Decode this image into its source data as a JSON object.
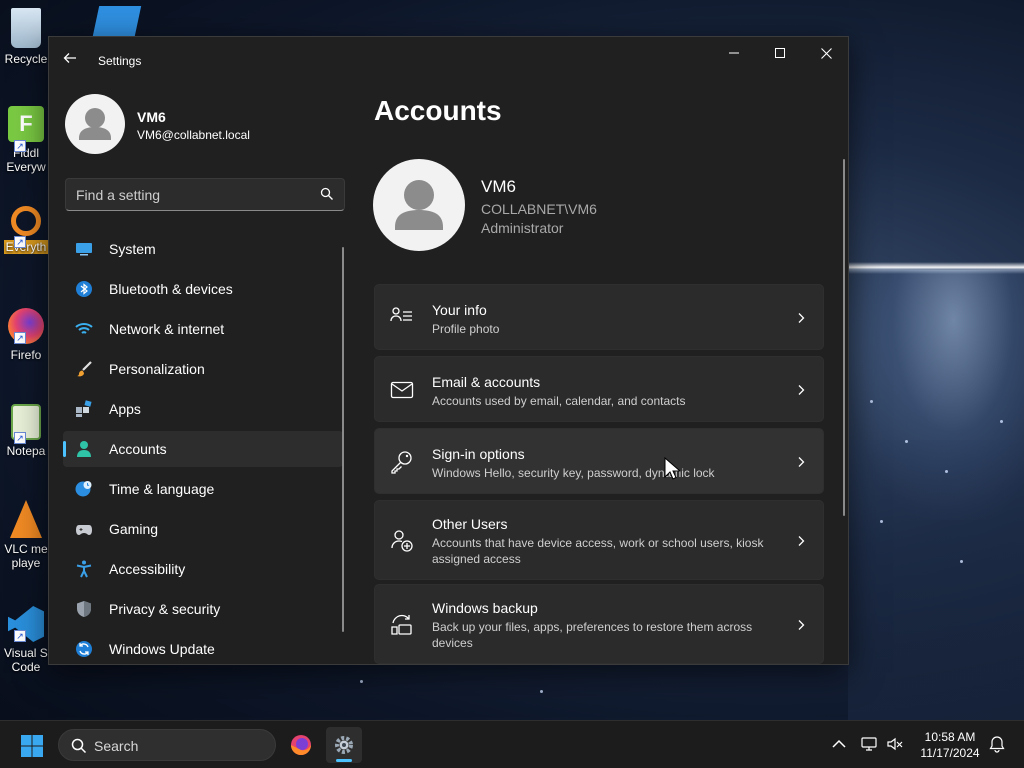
{
  "desktop": {
    "icons": [
      {
        "label": "Recycle"
      },
      {
        "label": "Fiddl"
      },
      {
        "label": "Everyw"
      },
      {
        "label": "Everyth"
      },
      {
        "label": "Firefo"
      },
      {
        "label": "Notepa"
      },
      {
        "label": "VLC me"
      },
      {
        "label": "playe"
      },
      {
        "label": "Visual St"
      },
      {
        "label": "Code"
      }
    ]
  },
  "window": {
    "title": "Settings",
    "profile": {
      "name": "VM6",
      "email": "VM6@collabnet.local"
    },
    "search_placeholder": "Find a setting",
    "nav": [
      {
        "label": "System",
        "icon": "monitor-icon"
      },
      {
        "label": "Bluetooth & devices",
        "icon": "bluetooth-icon"
      },
      {
        "label": "Network & internet",
        "icon": "wifi-icon"
      },
      {
        "label": "Personalization",
        "icon": "brush-icon"
      },
      {
        "label": "Apps",
        "icon": "apps-icon"
      },
      {
        "label": "Accounts",
        "icon": "person-icon",
        "active": true
      },
      {
        "label": "Time & language",
        "icon": "globe-clock-icon"
      },
      {
        "label": "Gaming",
        "icon": "gamepad-icon"
      },
      {
        "label": "Accessibility",
        "icon": "accessibility-icon"
      },
      {
        "label": "Privacy & security",
        "icon": "shield-icon"
      },
      {
        "label": "Windows Update",
        "icon": "update-icon"
      }
    ],
    "page": {
      "title": "Accounts",
      "account": {
        "name": "VM6",
        "domain": "COLLABNET\\VM6",
        "role": "Administrator"
      },
      "cards": [
        {
          "title": "Your info",
          "subtitle": "Profile photo",
          "icon": "person-lines-icon"
        },
        {
          "title": "Email & accounts",
          "subtitle": "Accounts used by email, calendar, and contacts",
          "icon": "mail-icon"
        },
        {
          "title": "Sign-in options",
          "subtitle": "Windows Hello, security key, password, dynamic lock",
          "icon": "key-icon"
        },
        {
          "title": "Other Users",
          "subtitle": "Accounts that have device access, work or school users, kiosk assigned access",
          "icon": "add-user-icon"
        },
        {
          "title": "Windows backup",
          "subtitle": "Back up your files, apps, preferences to restore them across devices",
          "icon": "backup-icon"
        }
      ]
    }
  },
  "taskbar": {
    "search_label": "Search",
    "time": "10:58 AM",
    "date": "11/17/2024"
  },
  "colors": {
    "accent": "#4cc2ff",
    "window_bg": "#202020",
    "card_bg": "#2b2b2b"
  }
}
